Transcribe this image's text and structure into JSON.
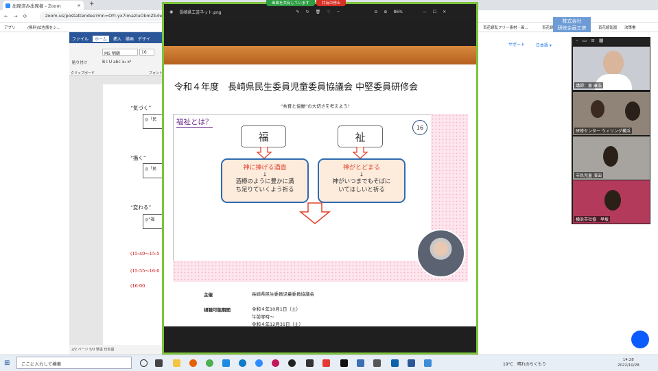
{
  "browser": {
    "tab_title": "出席済み出席者 - Zoom",
    "url": "zoom.us/postattendee?mn=OYI-yx7imazluOkmZb4wzb",
    "bookmarks": [
      "アプリ",
      "(無料)広告版をシ...",
      "百花繚乱フリー素材・画...",
      "百花繚乱は...",
      "百花繚乱版",
      "決策書"
    ],
    "right_links": [
      "サポート",
      "日本語 ▾"
    ]
  },
  "word": {
    "tabs": [
      "ファイル",
      "ホーム",
      "挿入",
      "描画",
      "デザイ"
    ],
    "font_name": "MS 明朝",
    "font_size": "16",
    "group_labels": [
      "貼り付け",
      "クリップボード",
      "フォント"
    ],
    "lines": [
      "“気づく”",
      "“描く”",
      "“変わる”"
    ],
    "boxes": [
      "◎「民",
      "◎「民",
      "◎“福"
    ],
    "times": [
      "(15:40～15:5",
      "(15:55～16:0",
      "(16:00"
    ],
    "status": "2/2 ページ   5/0 単語   日本語"
  },
  "viewer": {
    "filename": "長崎県工芸ネット.png",
    "zoom": "86%",
    "share_info": "画面を共有しています",
    "share_stop": "共有の停止"
  },
  "poster": {
    "title": "令和４年度　長崎県民生委員児童委員協議会 中堅委員研修会",
    "subtitle": "“共育と協働”の大切さを考えよう！",
    "slide": {
      "heading": "福祉とは？",
      "page_number": "16",
      "kanji_left": "福",
      "kanji_right": "祉",
      "card_left": {
        "head": "神に捧げる酒壺",
        "arrow": "↓",
        "body1": "酒樽のように豊かに満",
        "body2": "ち足りていくよう祈る"
      },
      "card_right": {
        "head": "神がとどまる",
        "arrow": "↓",
        "body1": "神がいつまでもそばに",
        "body2": "いてほしいと祈る"
      }
    },
    "info": [
      {
        "label": "主催",
        "value": "長崎県民生委員児童委員協議会"
      },
      {
        "label": "視聴可能期間",
        "value": "令和４年10月1日（土）"
      },
      {
        "label": "",
        "value": "午前零時～"
      },
      {
        "label": "",
        "value": "令和４年12月31日（土）"
      }
    ]
  },
  "zoom_gallery": {
    "badge": "株式会社\n研修企画工房",
    "participants": [
      "講師：東 康浩",
      "研修センター ウィリング横浜",
      "市民児童 濱田",
      "横浜市社協　早坂"
    ]
  },
  "taskbar": {
    "search_placeholder": "ここに入力して検索",
    "weather": "19°C　晴れのちくもり",
    "time": "14:28",
    "date": "2022/10/28"
  },
  "colors": {
    "share_green": "#2e9d44",
    "stop_red": "#d93025",
    "word_blue": "#2b579a",
    "card_border": "#2e6ab1",
    "slide_heading": "#6a2c8e"
  }
}
